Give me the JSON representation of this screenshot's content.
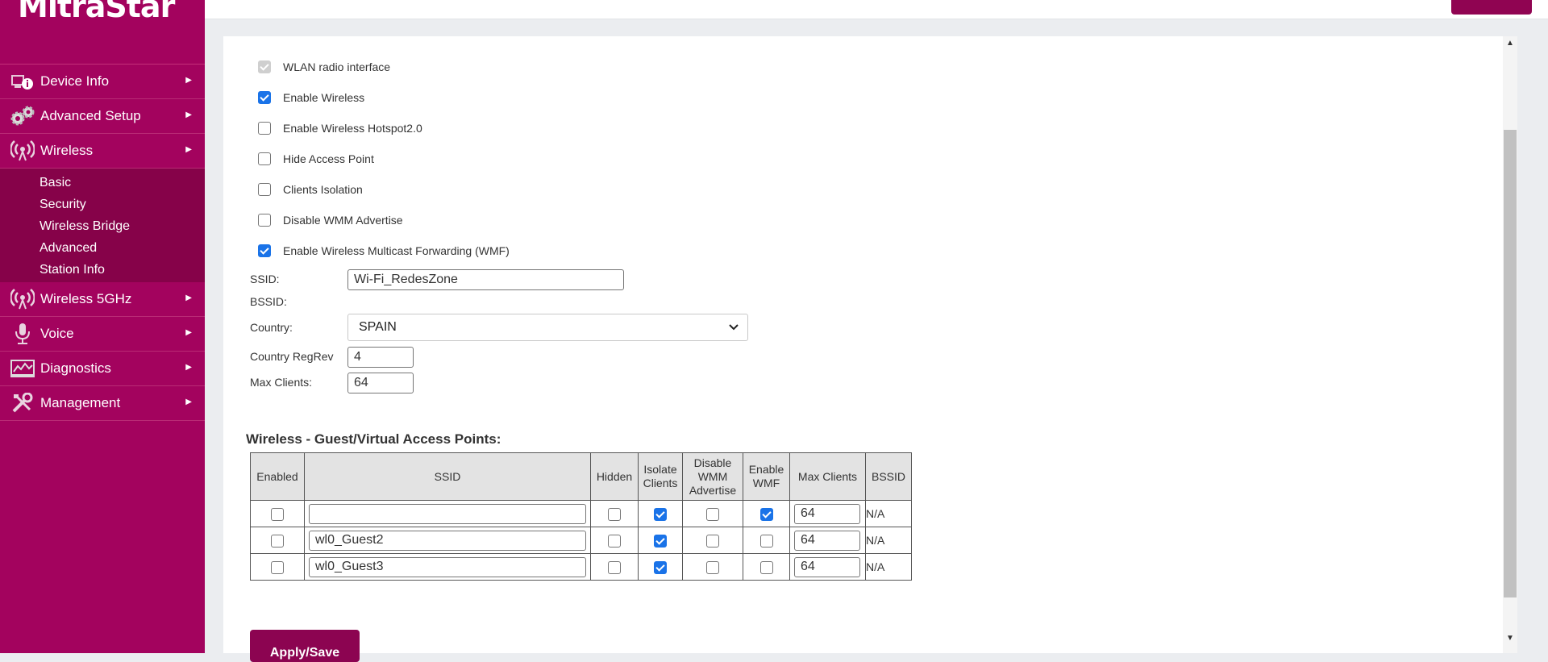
{
  "brand": {
    "logo_text": "MitraStar"
  },
  "sidebar": {
    "items": [
      {
        "label": "Device Info",
        "icon": "device-info-icon"
      },
      {
        "label": "Advanced Setup",
        "icon": "gears-icon"
      },
      {
        "label": "Wireless",
        "icon": "wireless-icon"
      },
      {
        "label": "Wireless 5GHz",
        "icon": "wireless-icon"
      },
      {
        "label": "Voice",
        "icon": "microphone-icon"
      },
      {
        "label": "Diagnostics",
        "icon": "diagnostics-icon"
      },
      {
        "label": "Management",
        "icon": "tools-icon"
      }
    ],
    "wireless_sub": [
      "Basic",
      "Security",
      "Wireless Bridge",
      "Advanced",
      "Station Info"
    ]
  },
  "options": [
    {
      "label": "WLAN radio interface",
      "state": "disabled-checked"
    },
    {
      "label": "Enable Wireless",
      "state": "checked"
    },
    {
      "label": "Enable Wireless Hotspot2.0",
      "state": "unchecked"
    },
    {
      "label": "Hide Access Point",
      "state": "unchecked"
    },
    {
      "label": "Clients Isolation",
      "state": "unchecked"
    },
    {
      "label": "Disable WMM Advertise",
      "state": "unchecked"
    },
    {
      "label": "Enable Wireless Multicast Forwarding (WMF)",
      "state": "checked"
    }
  ],
  "form": {
    "ssid_label": "SSID:",
    "ssid_value": "Wi-Fi_RedesZone",
    "bssid_label": "BSSID:",
    "country_label": "Country:",
    "country_value": "SPAIN",
    "regrev_label": "Country RegRev",
    "regrev_value": "4",
    "maxclients_label": "Max Clients:",
    "maxclients_value": "64"
  },
  "guest": {
    "title": "Wireless - Guest/Virtual Access Points:",
    "headers": {
      "enabled": "Enabled",
      "ssid": "SSID",
      "hidden": "Hidden",
      "isolate_1": "Isolate",
      "isolate_2": "Clients",
      "wmm_1": "Disable",
      "wmm_2": "WMM",
      "wmm_3": "Advertise",
      "wmf_1": "Enable",
      "wmf_2": "WMF",
      "max": "Max Clients",
      "bssid": "BSSID"
    },
    "rows": [
      {
        "enabled": false,
        "ssid": "",
        "hidden": false,
        "isolate": true,
        "wmm": false,
        "wmf": true,
        "max": "64",
        "bssid": "N/A"
      },
      {
        "enabled": false,
        "ssid": "wl0_Guest2",
        "hidden": false,
        "isolate": true,
        "wmm": false,
        "wmf": false,
        "max": "64",
        "bssid": "N/A"
      },
      {
        "enabled": false,
        "ssid": "wl0_Guest3",
        "hidden": false,
        "isolate": true,
        "wmm": false,
        "wmf": false,
        "max": "64",
        "bssid": "N/A"
      }
    ]
  },
  "apply_label": "Apply/Save"
}
